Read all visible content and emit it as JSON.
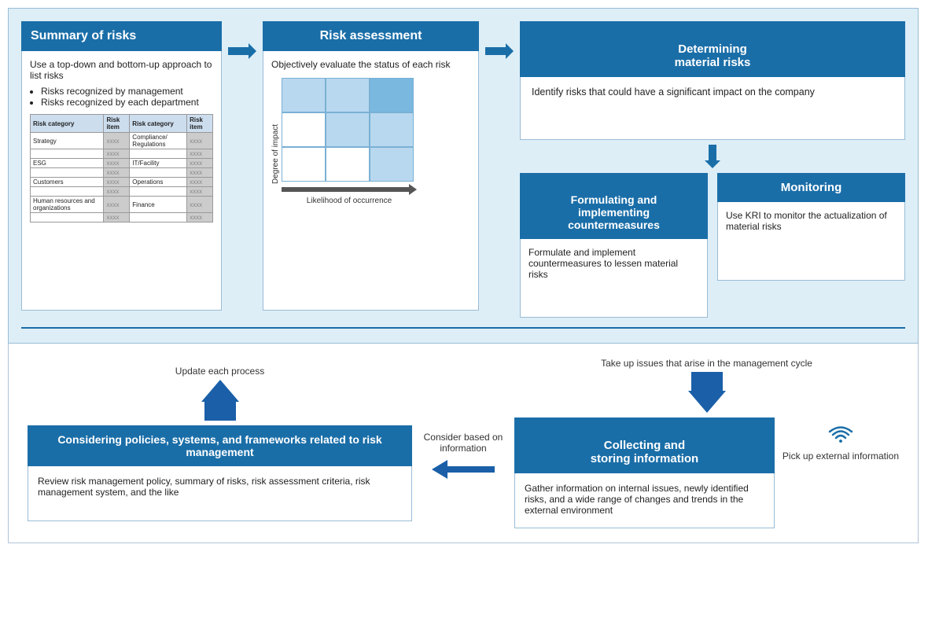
{
  "main": {
    "summary": {
      "header": "Summary of risks",
      "desc": "Use a top-down and bottom-up approach to list risks",
      "bullet1": "Risks recognized by management",
      "bullet2": "Risks recognized by each department",
      "table": {
        "col1_h1": "Risk category",
        "col1_h2": "Risk item",
        "col2_h1": "Risk category",
        "col2_h2": "Risk item",
        "rows": [
          {
            "cat1": "Strategy",
            "item1": "xxxx",
            "cat2": "Compliance/ Regulations",
            "item2": "xxxx"
          },
          {
            "cat1": "",
            "item1": "xxxx",
            "cat2": "",
            "item2": "xxxx"
          },
          {
            "cat1": "ESG",
            "item1": "xxxx",
            "cat2": "IT/Facility",
            "item2": "xxxx"
          },
          {
            "cat1": "",
            "item1": "xxxx",
            "cat2": "",
            "item2": "xxxx"
          },
          {
            "cat1": "Customers",
            "item1": "xxxx",
            "cat2": "Operations",
            "item2": "xxxx"
          },
          {
            "cat1": "",
            "item1": "xxxx",
            "cat2": "",
            "item2": "xxxx"
          },
          {
            "cat1": "Human resources and organizations",
            "item1": "xxxx",
            "cat2": "Finance",
            "item2": "xxxx"
          },
          {
            "cat1": "",
            "item1": "xxxx",
            "cat2": "",
            "item2": "xxxx"
          }
        ]
      }
    },
    "risk_assessment": {
      "header": "Risk assessment",
      "desc": "Objectively evaluate the status of each risk",
      "y_label": "Degree of impact",
      "x_label": "Likelihood of occurrence",
      "matrix": [
        [
          "light-blue",
          "light-blue",
          "blue"
        ],
        [
          "white",
          "light-blue",
          "light-blue"
        ],
        [
          "white",
          "white",
          "light-blue"
        ]
      ]
    },
    "determining": {
      "header": "Determining\nmaterial risks",
      "desc": "Identify risks that could have a significant impact on the company"
    },
    "formulating": {
      "header": "Formulating and\nimplementing\ncountermeasures",
      "desc": "Formulate and implement countermeasures to lessen material risks"
    },
    "monitoring": {
      "header": "Monitoring",
      "desc": "Use KRI to monitor the actualization of material risks"
    },
    "update_label": "Update each process",
    "take_up_label": "Take up issues that arise\nin the management cycle",
    "consider_label": "Consider based\non information",
    "pick_label": "Pick up external\ninformation",
    "policies": {
      "header": "Considering policies, systems, and frameworks related to risk management",
      "desc": "Review risk management policy, summary of risks, risk assessment criteria, risk management system, and the like"
    },
    "collecting": {
      "header": "Collecting and\nstoring information",
      "desc": "Gather information on internal issues, newly identified risks, and a wide range of changes and trends in the external environment"
    }
  }
}
